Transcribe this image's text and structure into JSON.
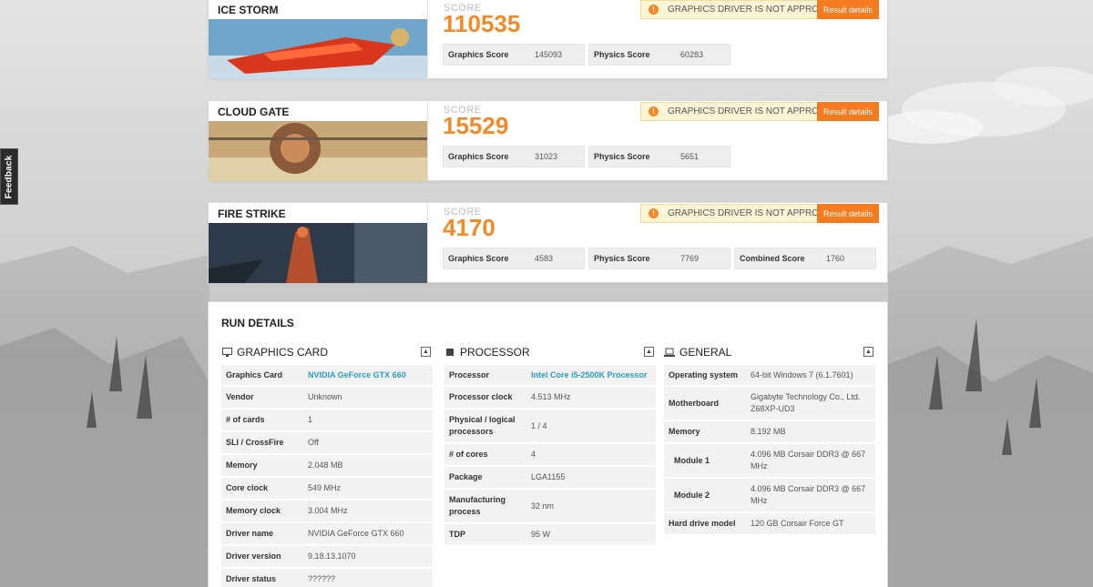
{
  "feedback_label": "Feedback",
  "benchmarks": [
    {
      "title": "ICE STORM",
      "score_label": "SCORE",
      "score": "110535",
      "warning": "GRAPHICS DRIVER IS NOT APPROVED",
      "button": "Result details",
      "subscores": [
        {
          "label": "Graphics Score",
          "value": "145093"
        },
        {
          "label": "Physics Score",
          "value": "60283"
        }
      ]
    },
    {
      "title": "CLOUD GATE",
      "score_label": "SCORE",
      "score": "15529",
      "warning": "GRAPHICS DRIVER IS NOT APPROVED",
      "button": "Result details",
      "subscores": [
        {
          "label": "Graphics Score",
          "value": "31023"
        },
        {
          "label": "Physics Score",
          "value": "5651"
        }
      ]
    },
    {
      "title": "FIRE STRIKE",
      "score_label": "SCORE",
      "score": "4170",
      "warning": "GRAPHICS DRIVER IS NOT APPROVED",
      "button": "Result details",
      "subscores": [
        {
          "label": "Graphics Score",
          "value": "4583"
        },
        {
          "label": "Physics Score",
          "value": "7769"
        },
        {
          "label": "Combined Score",
          "value": "1760"
        }
      ]
    }
  ],
  "run_details": {
    "title": "RUN DETAILS",
    "graphics_card": {
      "title": "GRAPHICS CARD",
      "rows": [
        {
          "label": "Graphics Card",
          "value": "NVIDIA GeForce GTX 660",
          "link": true
        },
        {
          "label": "Vendor",
          "value": "Unknown"
        },
        {
          "label": "# of cards",
          "value": "1"
        },
        {
          "label": "SLI / CrossFire",
          "value": "Off"
        },
        {
          "label": "Memory",
          "value": "2.048 MB"
        },
        {
          "label": "Core clock",
          "value": "549 MHz"
        },
        {
          "label": "Memory clock",
          "value": "3.004 MHz"
        },
        {
          "label": "Driver name",
          "value": "NVIDIA GeForce GTX 660"
        },
        {
          "label": "Driver version",
          "value": "9.18.13.1070"
        },
        {
          "label": "Driver status",
          "value": "??????"
        }
      ]
    },
    "processor": {
      "title": "PROCESSOR",
      "rows": [
        {
          "label": "Processor",
          "value": "Intel Core i5-2500K Processor",
          "link": true
        },
        {
          "label": "Processor clock",
          "value": "4.513 MHz"
        },
        {
          "label": "Physical / logical processors",
          "value": "1 / 4"
        },
        {
          "label": "# of cores",
          "value": "4"
        },
        {
          "label": "Package",
          "value": "LGA1155"
        },
        {
          "label": "Manufacturing process",
          "value": "32 nm"
        },
        {
          "label": "TDP",
          "value": "95 W"
        }
      ]
    },
    "general": {
      "title": "GENERAL",
      "rows": [
        {
          "label": "Operating system",
          "value": "64-bit Windows 7 (6.1.7601)"
        },
        {
          "label": "Motherboard",
          "value": "Gigabyte Technology Co., Ltd. Z68XP-UD3"
        },
        {
          "label": "Memory",
          "value": "8.192 MB"
        },
        {
          "label": "Module 1",
          "value": "4.096 MB Corsair DDR3 @ 667 MHz",
          "sub": true
        },
        {
          "label": "Module 2",
          "value": "4.096 MB Corsair DDR3 @ 667 MHz",
          "sub": true
        },
        {
          "label": "Hard drive model",
          "value": "120 GB Corsair Force GT"
        }
      ]
    }
  },
  "colors": {
    "accent_orange": "#f28a2a",
    "button_orange": "#f47b1f",
    "warning_bg": "#fdf5d6",
    "link_blue": "#2a9fc3"
  }
}
